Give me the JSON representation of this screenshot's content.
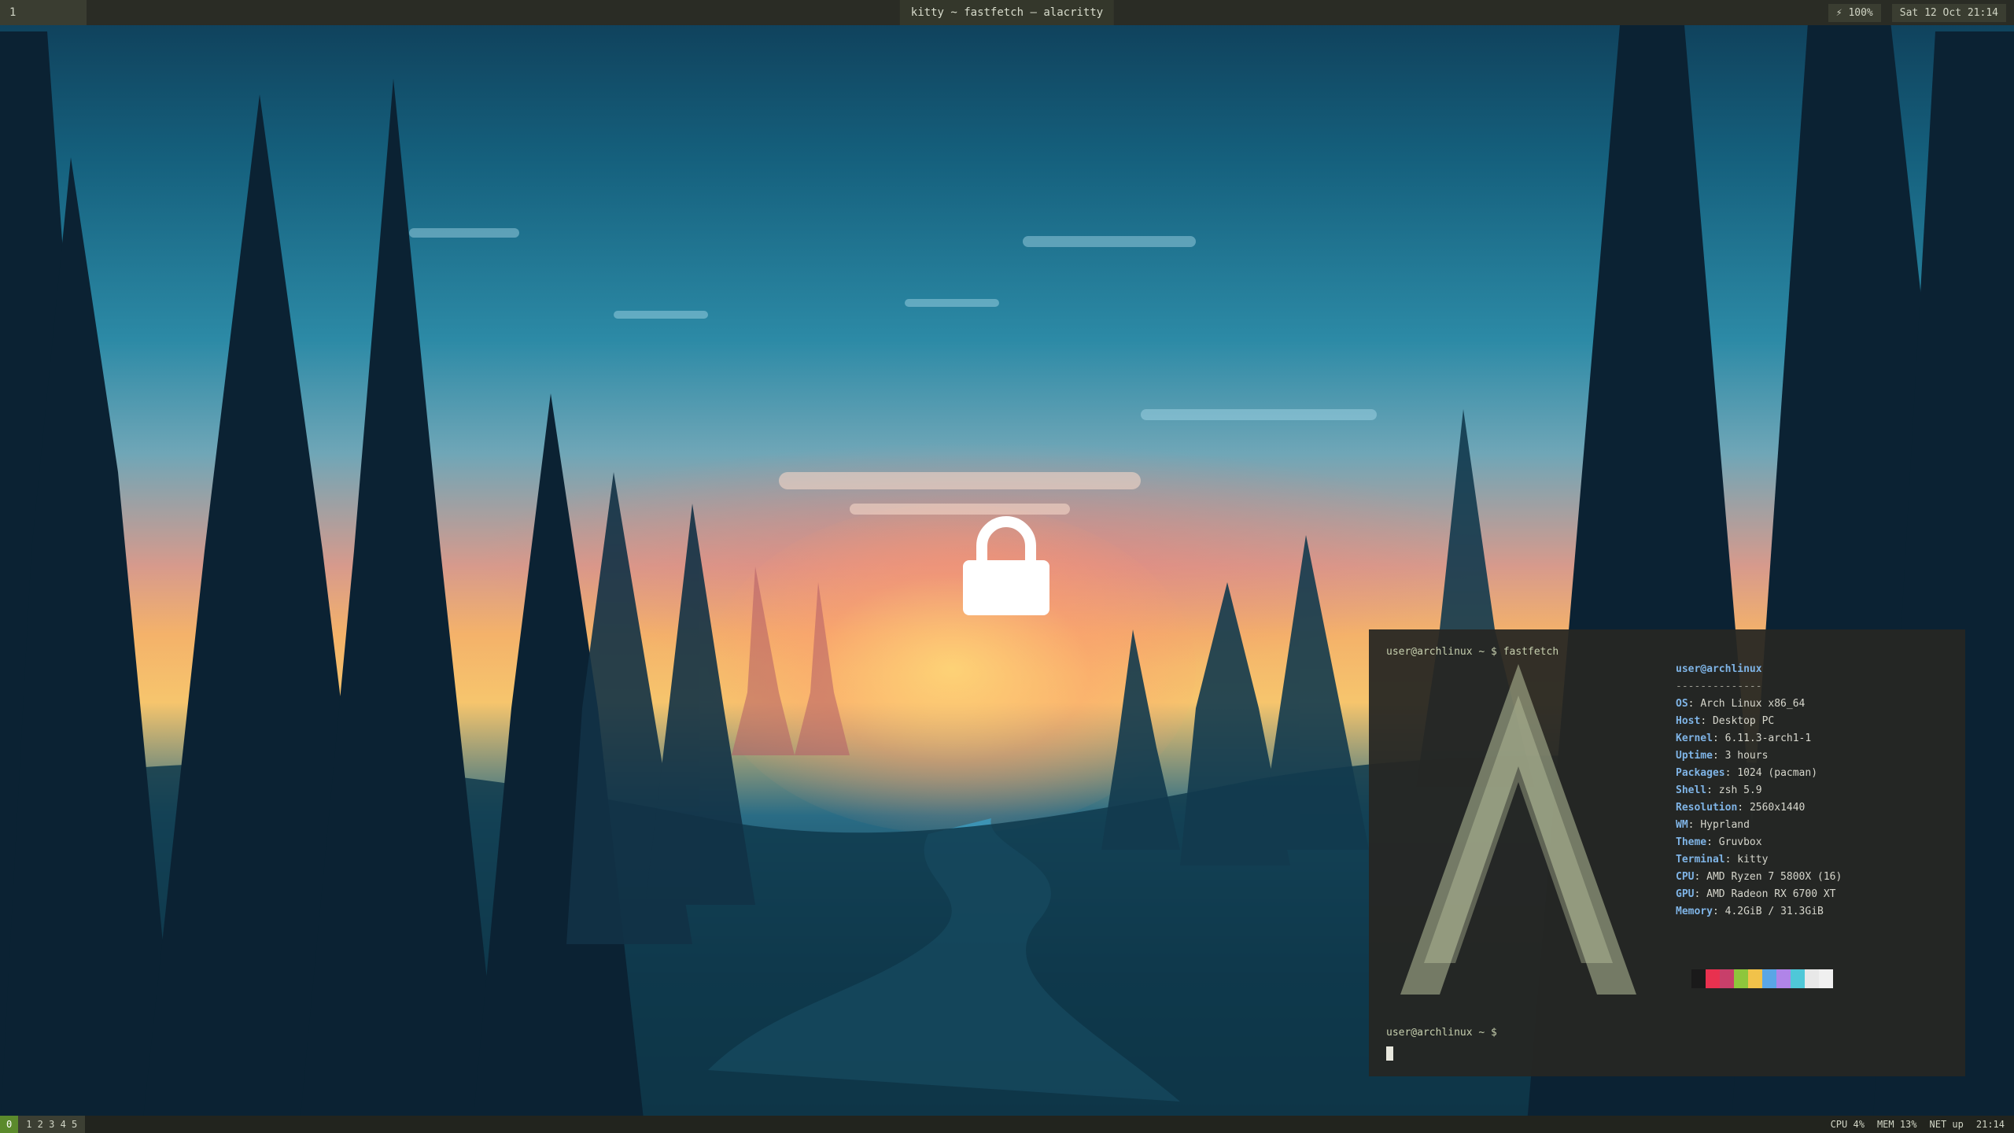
{
  "topbar": {
    "workspace": "1",
    "title": "kitty ~ fastfetch — alacritty",
    "right_items": [
      "⚡ 100%",
      "Sat 12 Oct 21:14"
    ]
  },
  "lockscreen": {
    "icon": "padlock-icon"
  },
  "terminal": {
    "prompt_top": "user@archlinux ~ $ fastfetch",
    "header": "user@archlinux",
    "separator": "--------------",
    "info": [
      {
        "key": "OS",
        "value": "Arch Linux x86_64"
      },
      {
        "key": "Host",
        "value": "Desktop PC"
      },
      {
        "key": "Kernel",
        "value": "6.11.3-arch1-1"
      },
      {
        "key": "Uptime",
        "value": "3 hours"
      },
      {
        "key": "Packages",
        "value": "1024 (pacman)"
      },
      {
        "key": "Shell",
        "value": "zsh 5.9"
      },
      {
        "key": "Resolution",
        "value": "2560x1440"
      },
      {
        "key": "WM",
        "value": "Hyprland"
      },
      {
        "key": "Theme",
        "value": "Gruvbox"
      },
      {
        "key": "Terminal",
        "value": "kitty"
      },
      {
        "key": "CPU",
        "value": "AMD Ryzen 7 5800X (16)"
      },
      {
        "key": "GPU",
        "value": "AMD Radeon RX 6700 XT"
      },
      {
        "key": "Memory",
        "value": "4.2GiB / 31.3GiB"
      }
    ],
    "palette": [
      "#1a1a1a",
      "#e8314f",
      "#c83f6a",
      "#8ec63c",
      "#f1c24a",
      "#5aa6e6",
      "#b084e8",
      "#4fc8d8",
      "#e8e8e8",
      "#f0f0f0"
    ],
    "prompt_bottom": "user@archlinux ~ $"
  },
  "bottombar": {
    "mode": "0",
    "tag": "1 2 3 4 5",
    "right_items": [
      "CPU 4%",
      "MEM 13%",
      "NET up",
      "21:14"
    ]
  }
}
